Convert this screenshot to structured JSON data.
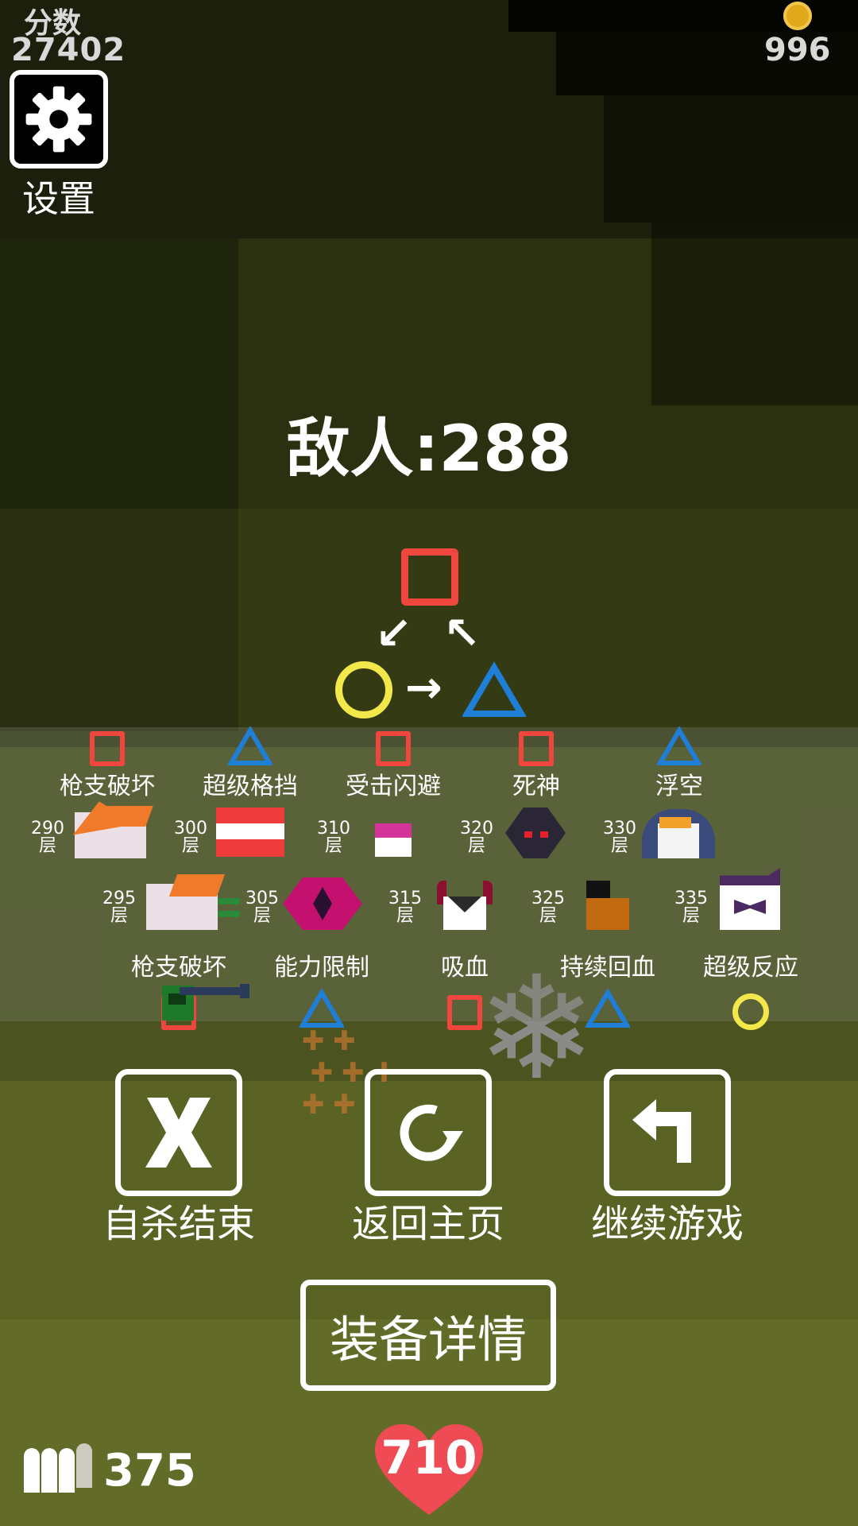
{
  "hud": {
    "score_label": "分数",
    "score_value": "27402",
    "coin_value": "996",
    "settings_label": "设置",
    "ammo_value": "375",
    "hp_value": "710"
  },
  "enemy": {
    "count_text": "敌人:288"
  },
  "skills_top": [
    {
      "label": "枪支破坏",
      "shape": "square"
    },
    {
      "label": "超级格挡",
      "shape": "triangle"
    },
    {
      "label": "受击闪避",
      "shape": "square"
    },
    {
      "label": "死神",
      "shape": "square"
    },
    {
      "label": "浮空",
      "shape": "triangle"
    }
  ],
  "floors_top": [
    {
      "num": "290",
      "unit": "层"
    },
    {
      "num": "300",
      "unit": "层"
    },
    {
      "num": "310",
      "unit": "层"
    },
    {
      "num": "320",
      "unit": "层"
    },
    {
      "num": "330",
      "unit": "层"
    }
  ],
  "floors_bottom": [
    {
      "num": "295",
      "unit": "层"
    },
    {
      "num": "305",
      "unit": "层"
    },
    {
      "num": "315",
      "unit": "层"
    },
    {
      "num": "325",
      "unit": "层"
    },
    {
      "num": "335",
      "unit": "层"
    }
  ],
  "skills_bottom": [
    {
      "label": "枪支破坏",
      "shape": "square"
    },
    {
      "label": "能力限制",
      "shape": "triangle"
    },
    {
      "label": "吸血",
      "shape": "square"
    },
    {
      "label": "持续回血",
      "shape": "triangle"
    },
    {
      "label": "超级反应",
      "shape": "circle"
    }
  ],
  "actions": {
    "suicide_label": "自杀结束",
    "home_label": "返回主页",
    "continue_label": "继续游戏",
    "equip_label": "装备详情"
  },
  "colors": {
    "square": "#f0463e",
    "triangle": "#1f7fd6",
    "circle": "#f2e84a",
    "heart": "#ee4b55"
  },
  "icons": {
    "settings": "gear-icon",
    "suicide": "x-icon",
    "home": "refresh-icon",
    "continue": "return-arrow-icon",
    "ammo": "bullets-icon",
    "coin": "coin-icon",
    "hp": "heart-icon"
  }
}
